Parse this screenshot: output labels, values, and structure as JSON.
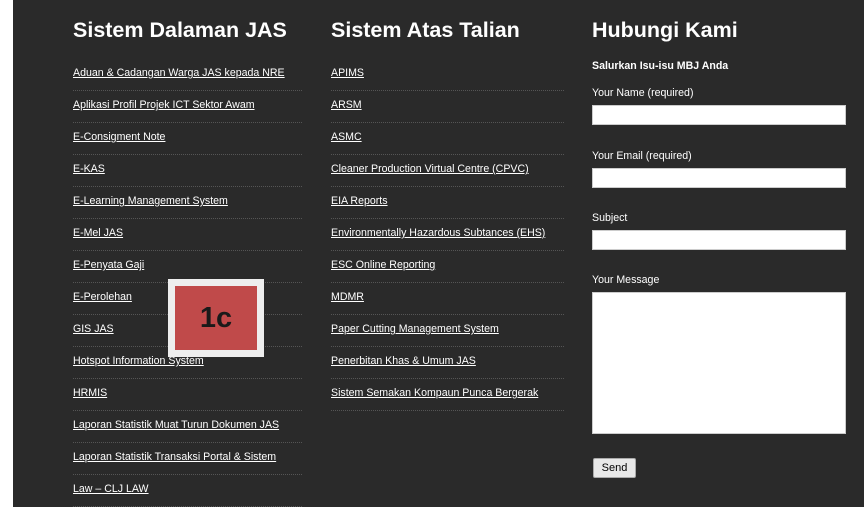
{
  "columns": {
    "internal": {
      "title": "Sistem Dalaman JAS",
      "links": [
        "Aduan & Cadangan Warga JAS kepada NRE",
        "Aplikasi Profil Projek ICT Sektor Awam",
        "E-Consigment Note",
        "E-KAS",
        "E-Learning Management System",
        "E-Mel JAS",
        "E-Penyata Gaji",
        "E-Perolehan",
        "GIS JAS",
        "Hotspot Information System",
        "HRMIS",
        "Laporan Statistik Muat Turun Dokumen JAS",
        "Laporan Statistik Transaksi Portal & Sistem",
        "Law – CLJ LAW"
      ]
    },
    "online": {
      "title": "Sistem Atas Talian",
      "links": [
        "APIMS",
        "ARSM",
        "ASMC",
        "Cleaner Production Virtual Centre (CPVC)",
        "EIA Reports",
        "Environmentally Hazardous Subtances (EHS)",
        "ESC Online Reporting",
        "MDMR",
        "Paper Cutting Management System",
        "Penerbitan Khas & Umum JAS",
        "Sistem Semakan Kompaun Punca Bergerak"
      ]
    }
  },
  "contact": {
    "title": "Hubungi Kami",
    "intro": "Salurkan Isu-isu MBJ Anda",
    "name_label": "Your Name (required)",
    "name_value": "",
    "email_label": "Your Email (required)",
    "email_value": "",
    "subject_label": "Subject",
    "subject_value": "",
    "message_label": "Your Message",
    "message_value": "",
    "send_label": "Send"
  },
  "callout": {
    "label": "1c",
    "color": "#c04a4a"
  }
}
